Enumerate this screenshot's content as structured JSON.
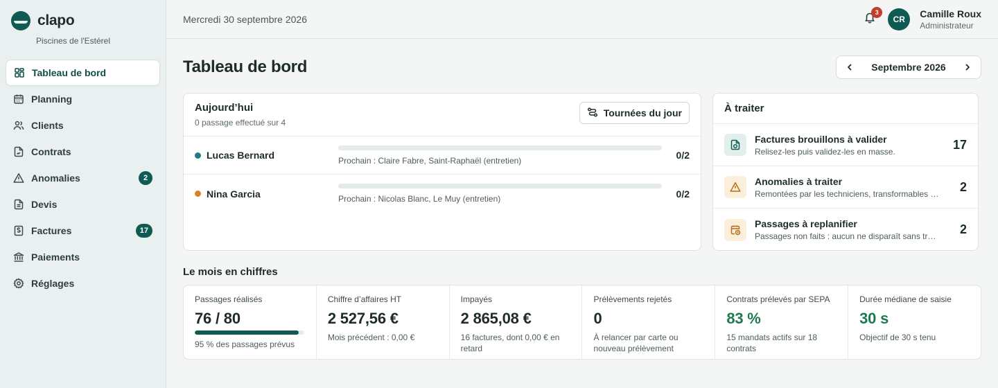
{
  "brand": {
    "name": "clapo",
    "subtitle": "Piscines de l'Estérel"
  },
  "sidebar": {
    "items": [
      {
        "label": "Tableau de bord",
        "icon": "dashboard-icon",
        "active": true
      },
      {
        "label": "Planning",
        "icon": "calendar-icon"
      },
      {
        "label": "Clients",
        "icon": "users-icon"
      },
      {
        "label": "Contrats",
        "icon": "contract-icon"
      },
      {
        "label": "Anomalies",
        "icon": "warning-icon",
        "badge": "2"
      },
      {
        "label": "Devis",
        "icon": "document-icon"
      },
      {
        "label": "Factures",
        "icon": "invoice-icon",
        "badge": "17"
      },
      {
        "label": "Paiements",
        "icon": "bank-icon"
      },
      {
        "label": "Réglages",
        "icon": "gear-icon"
      }
    ]
  },
  "header": {
    "date": "Mercredi 30 septembre 2026",
    "notifications_count": "3",
    "user": {
      "initials": "CR",
      "name": "Camille Roux",
      "role": "Administrateur"
    }
  },
  "page": {
    "title": "Tableau de bord",
    "month": "Septembre 2026"
  },
  "today": {
    "title": "Aujourd’hui",
    "subtitle": "0 passage effectué sur 4",
    "button_label": "Tournées du jour",
    "technicians": [
      {
        "name": "Lucas Bernard",
        "color": "#1f7a8c",
        "progress": 0,
        "next": "Prochain : Claire Fabre, Saint-Raphaël (entretien)",
        "count": "0/2"
      },
      {
        "name": "Nina Garcia",
        "color": "#d9822b",
        "progress": 0,
        "next": "Prochain : Nicolas Blanc, Le Muy (entretien)",
        "count": "0/2"
      }
    ]
  },
  "todo": {
    "title": "À traiter",
    "items": [
      {
        "title": "Factures brouillons à valider",
        "desc": "Relisez-les puis validez-les en masse.",
        "count": "17",
        "icon": "invoice-check-icon",
        "bg": "#e3efed",
        "fg": "#0f5a52"
      },
      {
        "title": "Anomalies à traiter",
        "desc": "Remontées par les techniciens, transformables en devis.",
        "count": "2",
        "icon": "warning-icon",
        "bg": "#fbefdc",
        "fg": "#b86e12"
      },
      {
        "title": "Passages à replanifier",
        "desc": "Passages non faits : aucun ne disparaît sans trace.",
        "count": "2",
        "icon": "calendar-clock-icon",
        "bg": "#fbefdc",
        "fg": "#b86e12"
      }
    ]
  },
  "month_stats": {
    "title": "Le mois en chiffres",
    "kpis": [
      {
        "label": "Passages réalisés",
        "value": "76 / 80",
        "progress": 0.95,
        "sub": "95 % des passages prévus"
      },
      {
        "label": "Chiffre d’affaires HT",
        "value": "2 527,56 €",
        "sub": "Mois précédent : 0,00 €"
      },
      {
        "label": "Impayés",
        "value": "2 865,08 €",
        "sub": "16 factures, dont 0,00 € en retard"
      },
      {
        "label": "Prélèvements rejetés",
        "value": "0",
        "sub": "À relancer par carte ou nouveau prélèvement"
      },
      {
        "label": "Contrats prélevés par SEPA",
        "value": "83 %",
        "green": true,
        "sub": "15 mandats actifs sur 18 contrats"
      },
      {
        "label": "Durée médiane de saisie",
        "value": "30 s",
        "green": true,
        "sub": "Objectif de 30 s tenu"
      }
    ]
  }
}
